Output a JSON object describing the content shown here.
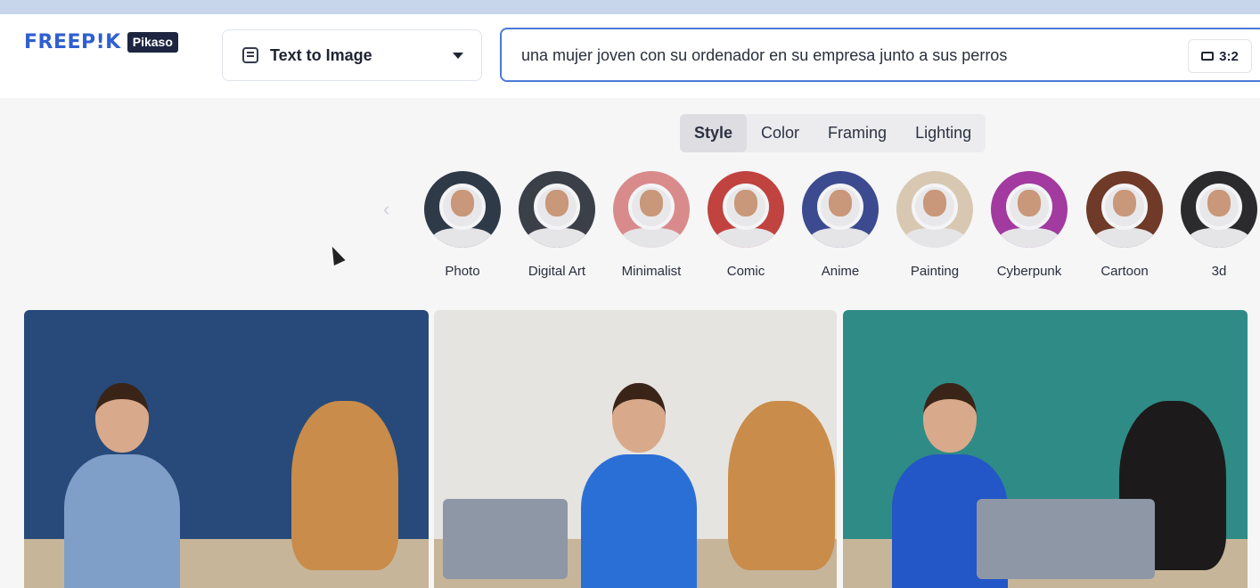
{
  "app": {
    "brand": "FREEP!K",
    "product": "Pikaso"
  },
  "mode_select": {
    "label": "Text to Image",
    "icon": "text-document-icon"
  },
  "prompt": {
    "value": "una mujer joven con su ordenador en su empresa junto a sus perros"
  },
  "aspect_ratio": {
    "label": "3:2",
    "icon": "rectangle-icon"
  },
  "tabs": [
    {
      "label": "Style",
      "active": true
    },
    {
      "label": "Color",
      "active": false
    },
    {
      "label": "Framing",
      "active": false
    },
    {
      "label": "Lighting",
      "active": false
    }
  ],
  "styles": [
    {
      "label": "Photo",
      "bg": "#2f3a48"
    },
    {
      "label": "Digital Art",
      "bg": "#3b3f48"
    },
    {
      "label": "Minimalist",
      "bg": "#d98b8c"
    },
    {
      "label": "Comic",
      "bg": "#c0433f"
    },
    {
      "label": "Anime",
      "bg": "#3c4b8f"
    },
    {
      "label": "Painting",
      "bg": "#d8c8b2"
    },
    {
      "label": "Cyberpunk",
      "bg": "#a23aa0"
    },
    {
      "label": "Cartoon",
      "bg": "#6f3a28"
    },
    {
      "label": "3d",
      "bg": "#2b2b2e"
    }
  ],
  "results": [
    {
      "wall": "#274a7a",
      "top": "blue-tank-top",
      "shirt": "#7f9fc9"
    },
    {
      "wall": "#e6e4e0",
      "top": "blue-sweater",
      "shirt": "#2a6fd6"
    },
    {
      "wall": "#2f8b86",
      "top": "blue-blouse",
      "shirt": "#2356c7"
    }
  ],
  "colors": {
    "accent": "#2f5fd0",
    "prompt_border": "#4a7ad8",
    "badge": "#1d2540"
  }
}
